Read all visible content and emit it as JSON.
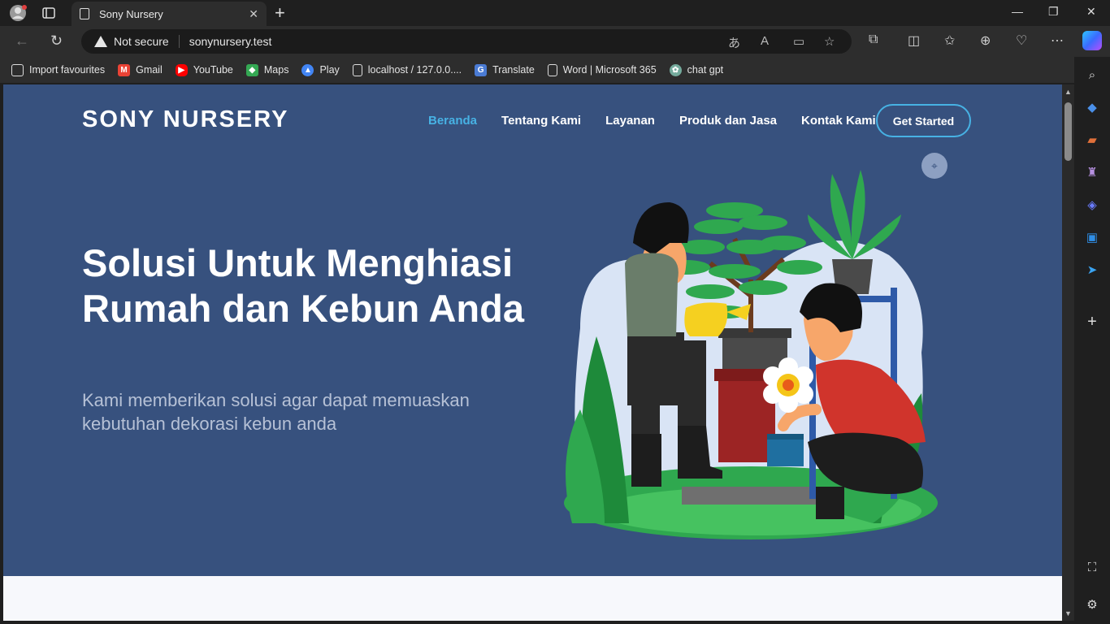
{
  "browser": {
    "tab_title": "Sony Nursery",
    "close_tab": "✕",
    "new_tab": "+",
    "security_label": "Not secure",
    "url": "sonynursery.test",
    "window_controls": [
      "—",
      "❐",
      "✕"
    ]
  },
  "bookmarks": [
    {
      "label": "Import favourites",
      "icon": "import-icon",
      "color": "#2d2d2d"
    },
    {
      "label": "Gmail",
      "icon": "gmail-icon",
      "color": "#ea4335"
    },
    {
      "label": "YouTube",
      "icon": "youtube-icon",
      "color": "#ff0000"
    },
    {
      "label": "Maps",
      "icon": "maps-icon",
      "color": "#34a853"
    },
    {
      "label": "Play",
      "icon": "play-icon",
      "color": "#4285f4"
    },
    {
      "label": "localhost / 127.0.0....",
      "icon": "page-icon",
      "color": "#2d2d2d"
    },
    {
      "label": "Translate",
      "icon": "translate-icon",
      "color": "#4a7bd4"
    },
    {
      "label": "Word | Microsoft 365",
      "icon": "page-icon",
      "color": "#2d2d2d"
    },
    {
      "label": "chat gpt",
      "icon": "chatgpt-icon",
      "color": "#74aa9c"
    }
  ],
  "site": {
    "logo": "SONY NURSERY",
    "nav": [
      "Beranda",
      "Tentang Kami",
      "Layanan",
      "Produk dan Jasa",
      "Kontak Kami"
    ],
    "active_nav": "Beranda",
    "cta": "Get Started",
    "headline": "Solusi Untuk Menghiasi Rumah dan Kebun Anda",
    "subheadline": "Kami memberikan solusi agar dapat memuaskan kebutuhan dekorasi kebun anda",
    "colors": {
      "hero_bg": "#37517e",
      "accent": "#47b2e4"
    }
  }
}
